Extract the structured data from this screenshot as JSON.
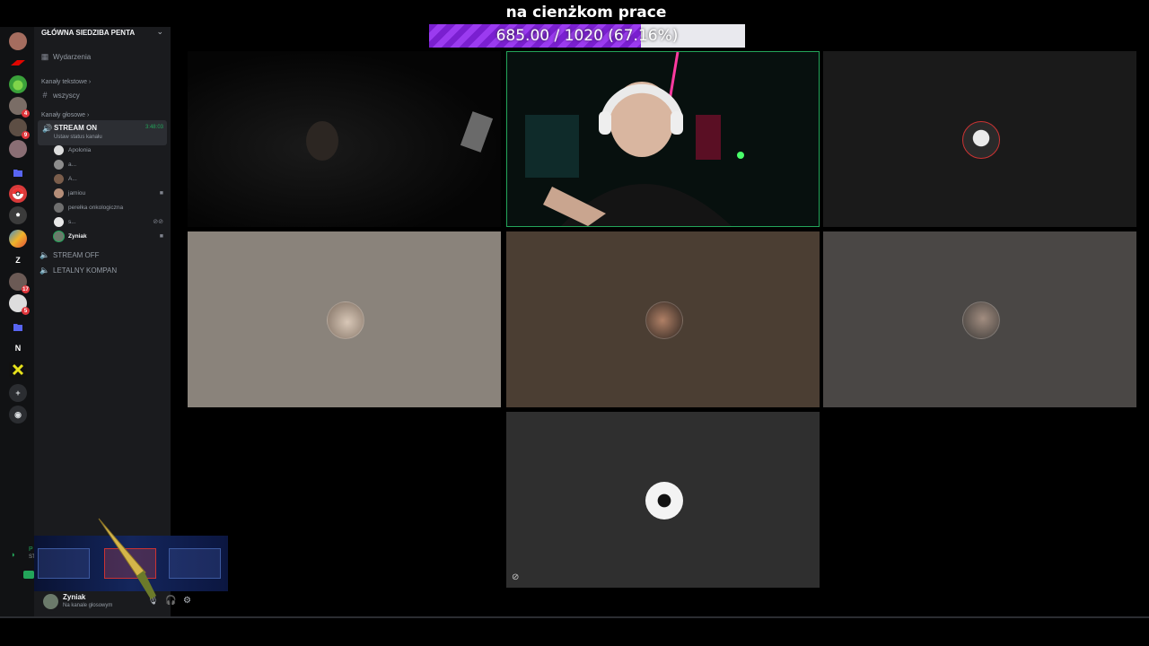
{
  "overlay": {
    "title": "na cienżkom prace",
    "progress_text": "685.00 / 1020 (67.16%)",
    "progress_fraction": 0.6716,
    "fill_color": "#8a2be2"
  },
  "rail": {
    "servers": [
      {
        "icon": "avatar-icon",
        "badge": ""
      },
      {
        "icon": "f1-logo-icon",
        "badge": ""
      },
      {
        "icon": "apple-icon",
        "badge": ""
      },
      {
        "icon": "server-icon",
        "badge": "4"
      },
      {
        "icon": "server-icon",
        "badge": "9"
      },
      {
        "icon": "server-icon",
        "badge": ""
      },
      {
        "icon": "folder-icon",
        "badge": ""
      },
      {
        "icon": "pokeball-icon",
        "badge": ""
      },
      {
        "icon": "pentagon-icon",
        "badge": ""
      },
      {
        "icon": "map-icon",
        "badge": ""
      },
      {
        "icon": "letter-icon",
        "label": "Z",
        "badge": ""
      },
      {
        "icon": "server-icon",
        "badge": "17"
      },
      {
        "icon": "server-icon",
        "badge": "5"
      },
      {
        "icon": "folder-icon",
        "badge": ""
      },
      {
        "icon": "letter-icon",
        "label": "N",
        "badge": ""
      },
      {
        "icon": "x-logo-icon",
        "badge": ""
      },
      {
        "icon": "add-server-icon",
        "badge": ""
      },
      {
        "icon": "discover-icon",
        "badge": ""
      }
    ]
  },
  "sidebar": {
    "guild_name": "GŁÓWNA SIEDZIBA PENTA",
    "events_label": "Wydarzenia",
    "text_category": "Kanały tekstowe",
    "text_channel": "wszyscy",
    "voice_category": "Kanały głosowe",
    "active_voice": {
      "name": "STREAM ON",
      "time": "3:48:03",
      "status": "Ustaw status kanału"
    },
    "members": [
      {
        "name": "Apolonia",
        "icon": ""
      },
      {
        "name": "a...",
        "icon": ""
      },
      {
        "name": "A...",
        "icon": ""
      },
      {
        "name": "jamiou",
        "icon": "camera-icon"
      },
      {
        "name": "perełka onkologiczna",
        "icon": ""
      },
      {
        "name": "s...",
        "icon": "muted-deafened-icon"
      },
      {
        "name": "Zyniak",
        "icon": "camera-icon"
      }
    ],
    "other_voice": [
      "STREAM OFF",
      "LETALNY KOMPAN"
    ]
  },
  "user_panel": {
    "name": "Zyniak",
    "status": "Na kanale głosowym"
  },
  "voice_mini": {
    "label": "P",
    "sublabel": "ST"
  },
  "colors": {
    "speaking_border": "#23a55a",
    "tile_beige": "#8a837b",
    "tile_brown": "#4b3e33",
    "tile_grey": "#4a4745",
    "tile_dark": "#2f2f2f"
  }
}
